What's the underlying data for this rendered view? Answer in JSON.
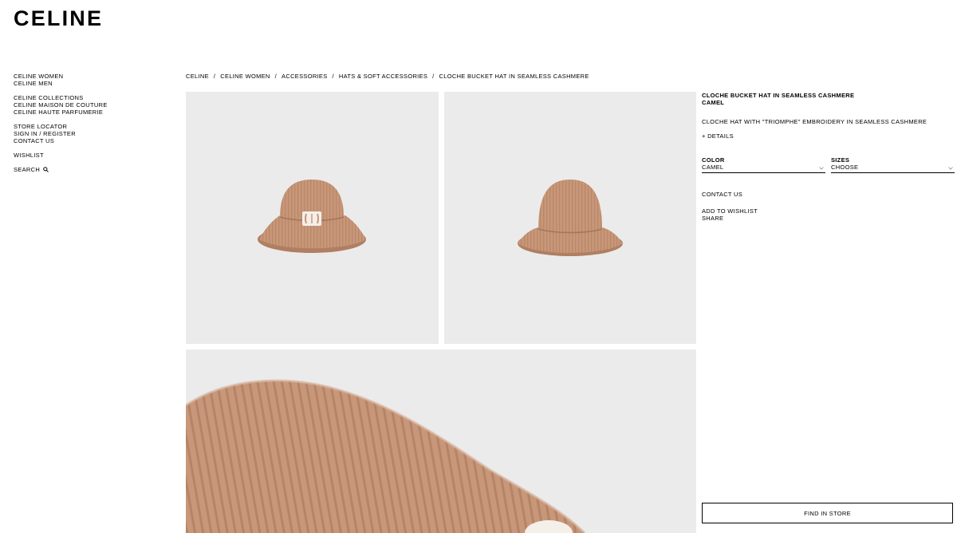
{
  "brand": {
    "logo": "CELINE"
  },
  "nav": {
    "group1": [
      "CELINE WOMEN",
      "CELINE MEN"
    ],
    "group2": [
      "CELINE COLLECTIONS",
      "CELINE MAISON DE COUTURE",
      "CELINE HAUTE PARFUMERIE"
    ],
    "group3": [
      "STORE LOCATOR",
      "SIGN IN / REGISTER",
      "CONTACT US"
    ],
    "wishlist": "WISHLIST",
    "search": "SEARCH"
  },
  "breadcrumb": [
    "CELINE",
    "CELINE WOMEN",
    "ACCESSORIES",
    "HATS & SOFT ACCESSORIES",
    "CLOCHE BUCKET HAT IN SEAMLESS CASHMERE"
  ],
  "breadcrumb_separator": "/",
  "product": {
    "name": "CLOCHE BUCKET HAT IN SEAMLESS CASHMERE",
    "color_name": "CAMEL",
    "description": "CLOCHE HAT WITH \"TRIOMPHE\" EMBROIDERY IN SEAMLESS CASHMERE",
    "details_link": "+ DETAILS",
    "color_label": "COLOR",
    "color_value": "CAMEL",
    "sizes_label": "SIZES",
    "sizes_value": "CHOOSE",
    "contact": "CONTACT US",
    "add_wishlist": "ADD TO WISHLIST",
    "share": "SHARE",
    "find_in_store": "FIND IN STORE"
  },
  "colors": {
    "hat": "#c8977a",
    "hat_dark": "#b07e62",
    "tile_bg": "#ebebeb",
    "logo_patch": "#f4efe9"
  }
}
